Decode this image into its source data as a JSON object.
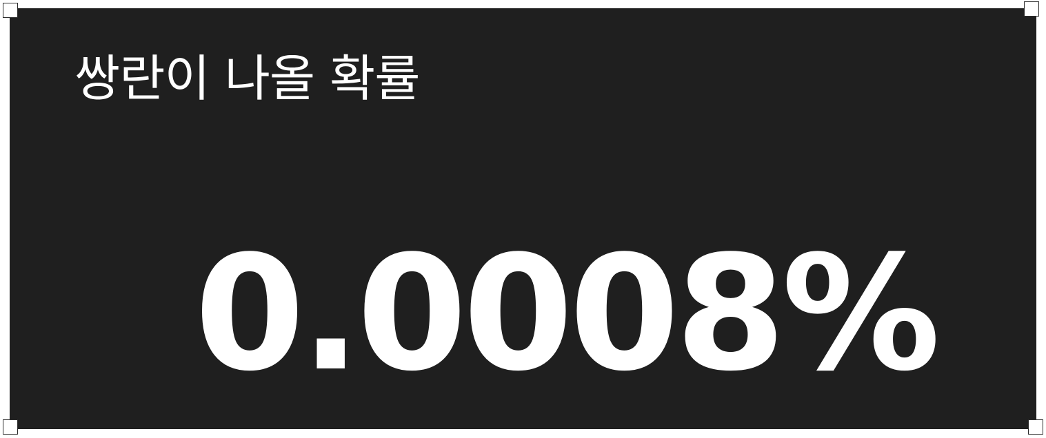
{
  "card": {
    "label": "쌍란이 나올 확률",
    "value": "0.0008%",
    "background_color": "#1f1f1f",
    "text_color": "#ffffff"
  }
}
